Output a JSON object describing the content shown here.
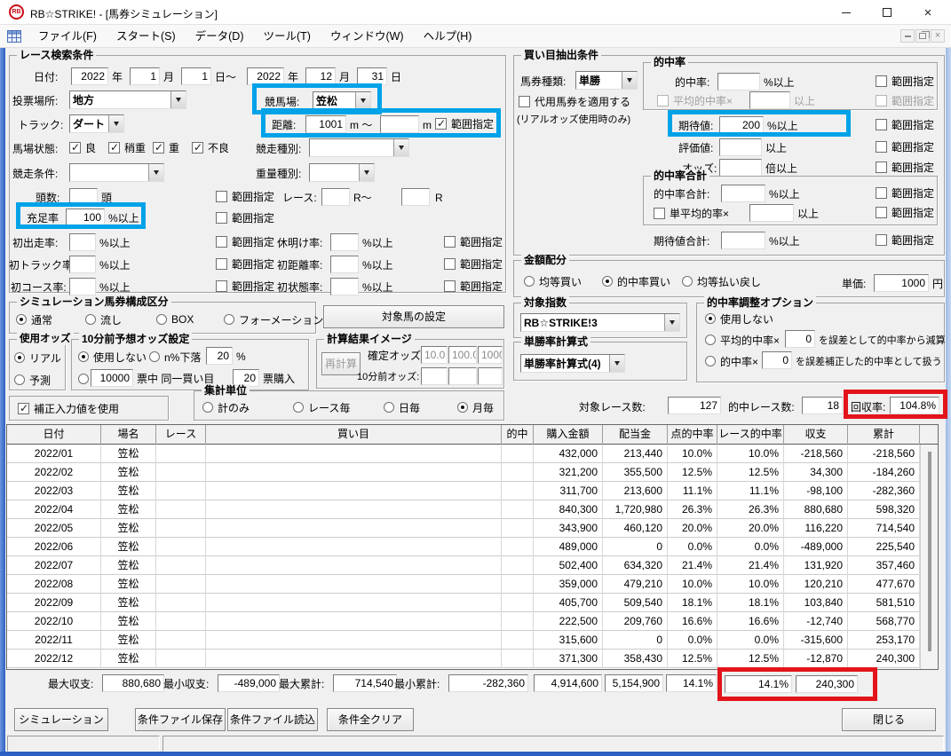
{
  "window": {
    "title": "RB☆STRIKE! - [馬券シミュレーション]",
    "icon_text": "RB"
  },
  "menu": {
    "items": [
      "ファイル(F)",
      "スタート(S)",
      "データ(D)",
      "ツール(T)",
      "ウィンドウ(W)",
      "ヘルプ(H)"
    ]
  },
  "common": {
    "range": "範囲指定",
    "pct_min": "%以上",
    "min": "以上"
  },
  "race_search": {
    "title": "レース検索条件",
    "date": {
      "label": "日付:",
      "year1": "2022",
      "year_u1": "年",
      "month1": "1",
      "month_u1": "月",
      "day1": "1",
      "day_to_u": "日～",
      "year2": "2022",
      "year_u2": "年",
      "month2": "12",
      "month_u2": "月",
      "day2": "31",
      "day_u": "日"
    },
    "place": {
      "label": "投票場所:",
      "value": "地方"
    },
    "course": {
      "label": "競馬場:",
      "value": "笠松"
    },
    "track": {
      "label": "トラック:",
      "value": "ダート"
    },
    "distance": {
      "label": "距離:",
      "from": "1001",
      "u1": "m ～",
      "to": "",
      "u2": "m"
    },
    "going": {
      "label": "馬場状態:",
      "opts": [
        "良",
        "稍重",
        "重",
        "不良"
      ]
    },
    "race_type": {
      "label": "競走種別:",
      "value": ""
    },
    "race_cond": {
      "label": "競走条件:",
      "value": ""
    },
    "weight_type": {
      "label": "重量種別:",
      "value": ""
    },
    "heads": {
      "label": "頭数:",
      "value": "",
      "unit": "頭"
    },
    "race_no": {
      "label": "レース:",
      "from": "",
      "u1": "R～",
      "to": "",
      "u2": "R"
    },
    "fill_rate": {
      "label": "充足率",
      "value": "100"
    },
    "first_run": {
      "label": "初出走率:",
      "value": ""
    },
    "rest_return": {
      "label": "休明け率:",
      "value": ""
    },
    "first_track": {
      "label": "初トラック率:",
      "value": ""
    },
    "first_dist": {
      "label": "初距離率:",
      "value": ""
    },
    "first_course": {
      "label": "初コース率:",
      "value": ""
    },
    "first_going": {
      "label": "初状態率:",
      "value": ""
    }
  },
  "sim_type": {
    "title": "シミュレーション馬券構成区分",
    "opts": [
      "通常",
      "流し",
      "BOX",
      "フォーメーション"
    ],
    "selected": "通常"
  },
  "target_horse_btn": "対象馬の設定",
  "odds_use": {
    "title": "使用オッズ",
    "opts": [
      "リアル",
      "予測"
    ],
    "selected": "リアル"
  },
  "pre_odds": {
    "title": "10分前予想オッズ設定",
    "opt1": "使用しない",
    "opt2": "n%下落",
    "pct": "20",
    "pct_u": "%",
    "votes": "10000",
    "votes_u": "票中 同一買い目",
    "buy": "20",
    "buy_u": "票購入",
    "selected": "使用しない"
  },
  "calc_image": {
    "title": "計算結果イメージ",
    "recalc_btn": "再計算",
    "fixed_label": "確定オッズ:",
    "fixed": [
      "10.0",
      "100.0",
      "1000"
    ],
    "pre_label": "10分前オッズ:",
    "pre": [
      "",
      "",
      ""
    ]
  },
  "correction": {
    "label": "補正入力値を使用",
    "checked": true
  },
  "agg_unit": {
    "title": "集計単位",
    "opts": [
      "計のみ",
      "レース毎",
      "日毎",
      "月毎"
    ],
    "selected": "月毎"
  },
  "extract": {
    "title": "買い目抽出条件",
    "ticket_type": {
      "label": "馬券種類:",
      "value": "単勝"
    },
    "substitute": {
      "label": "代用馬券を適用する",
      "note": "(リアルオッズ使用時のみ)"
    },
    "hit_group": {
      "title": "的中率",
      "hit_rate": {
        "label": "的中率:",
        "value": ""
      },
      "avg_hit": {
        "label": "平均的中率×",
        "value": ""
      }
    },
    "expectation": {
      "label": "期待値:",
      "value": "200"
    },
    "evaluation": {
      "label": "評価値:",
      "value": ""
    },
    "odds": {
      "label": "オッズ:",
      "value": "",
      "unit": "倍以上"
    },
    "hit_total_group": {
      "title": "的中率合計",
      "hit_total": {
        "label": "的中率合計:",
        "value": ""
      },
      "avg_single": {
        "label": "単平均的率×",
        "value": ""
      }
    },
    "expect_total": {
      "label": "期待値合計:",
      "value": ""
    }
  },
  "allocation": {
    "title": "金額配分",
    "opts": [
      "均等買い",
      "的中率買い",
      "均等払い戻し"
    ],
    "selected": "的中率買い",
    "unit_label": "単価:",
    "unit_value": "1000",
    "unit_suffix": "円"
  },
  "target_index": {
    "title": "対象指数",
    "value": "RB☆STRIKE!3"
  },
  "win_formula": {
    "title": "単勝率計算式",
    "value": "単勝率計算式(4)"
  },
  "hit_adjust": {
    "title": "的中率調整オプション",
    "opt1": "使用しない",
    "opt2_pre": "平均的中率×",
    "opt2_val": "0",
    "opt2_post": "を誤差として的中率から減算",
    "opt3_pre": "的中率×",
    "opt3_val": "0",
    "opt3_post": "を誤差補正した的中率として扱う",
    "selected": "使用しない"
  },
  "stats": {
    "target_label": "対象レース数:",
    "target_value": "127",
    "hit_label": "的中レース数:",
    "hit_value": "18",
    "recovery_label": "回収率:",
    "recovery_value": "104.8%"
  },
  "table": {
    "columns": [
      "日付",
      "場名",
      "レース",
      "買い目",
      "的中",
      "購入金額",
      "配当金",
      "点的中率",
      "レース的中率",
      "収支",
      "累計"
    ],
    "row_keys": [
      "date",
      "venue",
      "race",
      "kaime",
      "hit",
      "purchase",
      "payout",
      "point_rate",
      "race_rate",
      "balance",
      "cumulative"
    ],
    "rows": [
      {
        "date": "2022/01",
        "venue": "笠松",
        "race": "",
        "kaime": "",
        "hit": "",
        "purchase": "432,000",
        "payout": "213,440",
        "point_rate": "10.0%",
        "race_rate": "10.0%",
        "balance": "-218,560",
        "cumulative": "-218,560"
      },
      {
        "date": "2022/02",
        "venue": "笠松",
        "race": "",
        "kaime": "",
        "hit": "",
        "purchase": "321,200",
        "payout": "355,500",
        "point_rate": "12.5%",
        "race_rate": "12.5%",
        "balance": "34,300",
        "cumulative": "-184,260"
      },
      {
        "date": "2022/03",
        "venue": "笠松",
        "race": "",
        "kaime": "",
        "hit": "",
        "purchase": "311,700",
        "payout": "213,600",
        "point_rate": "11.1%",
        "race_rate": "11.1%",
        "balance": "-98,100",
        "cumulative": "-282,360"
      },
      {
        "date": "2022/04",
        "venue": "笠松",
        "race": "",
        "kaime": "",
        "hit": "",
        "purchase": "840,300",
        "payout": "1,720,980",
        "point_rate": "26.3%",
        "race_rate": "26.3%",
        "balance": "880,680",
        "cumulative": "598,320"
      },
      {
        "date": "2022/05",
        "venue": "笠松",
        "race": "",
        "kaime": "",
        "hit": "",
        "purchase": "343,900",
        "payout": "460,120",
        "point_rate": "20.0%",
        "race_rate": "20.0%",
        "balance": "116,220",
        "cumulative": "714,540"
      },
      {
        "date": "2022/06",
        "venue": "笠松",
        "race": "",
        "kaime": "",
        "hit": "",
        "purchase": "489,000",
        "payout": "0",
        "point_rate": "0.0%",
        "race_rate": "0.0%",
        "balance": "-489,000",
        "cumulative": "225,540"
      },
      {
        "date": "2022/07",
        "venue": "笠松",
        "race": "",
        "kaime": "",
        "hit": "",
        "purchase": "502,400",
        "payout": "634,320",
        "point_rate": "21.4%",
        "race_rate": "21.4%",
        "balance": "131,920",
        "cumulative": "357,460"
      },
      {
        "date": "2022/08",
        "venue": "笠松",
        "race": "",
        "kaime": "",
        "hit": "",
        "purchase": "359,000",
        "payout": "479,210",
        "point_rate": "10.0%",
        "race_rate": "10.0%",
        "balance": "120,210",
        "cumulative": "477,670"
      },
      {
        "date": "2022/09",
        "venue": "笠松",
        "race": "",
        "kaime": "",
        "hit": "",
        "purchase": "405,700",
        "payout": "509,540",
        "point_rate": "18.1%",
        "race_rate": "18.1%",
        "balance": "103,840",
        "cumulative": "581,510"
      },
      {
        "date": "2022/10",
        "venue": "笠松",
        "race": "",
        "kaime": "",
        "hit": "",
        "purchase": "222,500",
        "payout": "209,760",
        "point_rate": "16.6%",
        "race_rate": "16.6%",
        "balance": "-12,740",
        "cumulative": "568,770"
      },
      {
        "date": "2022/11",
        "venue": "笠松",
        "race": "",
        "kaime": "",
        "hit": "",
        "purchase": "315,600",
        "payout": "0",
        "point_rate": "0.0%",
        "race_rate": "0.0%",
        "balance": "-315,600",
        "cumulative": "253,170"
      },
      {
        "date": "2022/12",
        "venue": "笠松",
        "race": "",
        "kaime": "",
        "hit": "",
        "purchase": "371,300",
        "payout": "358,430",
        "point_rate": "12.5%",
        "race_rate": "12.5%",
        "balance": "-12,870",
        "cumulative": "240,300"
      }
    ]
  },
  "summary": {
    "max_balance_label": "最大収支:",
    "max_balance": "880,680",
    "min_balance_label": "最小収支:",
    "min_balance": "-489,000",
    "max_cum_label": "最大累計:",
    "max_cum": "714,540",
    "min_cum_label": "最小累計:",
    "min_cum": "-282,360",
    "total_purchase": "4,914,600",
    "total_payout": "5,154,900",
    "total_point_rate": "14.1%",
    "total_race_rate": "14.1%",
    "total_cumulative": "240,300"
  },
  "buttons": {
    "simulate": "シミュレーション",
    "save": "条件ファイル保存",
    "load": "条件ファイル読込",
    "clear": "条件全クリア",
    "close": "閉じる"
  },
  "colors": {
    "highlight_blue": "#00a2e8",
    "highlight_red": "#e3141a"
  }
}
